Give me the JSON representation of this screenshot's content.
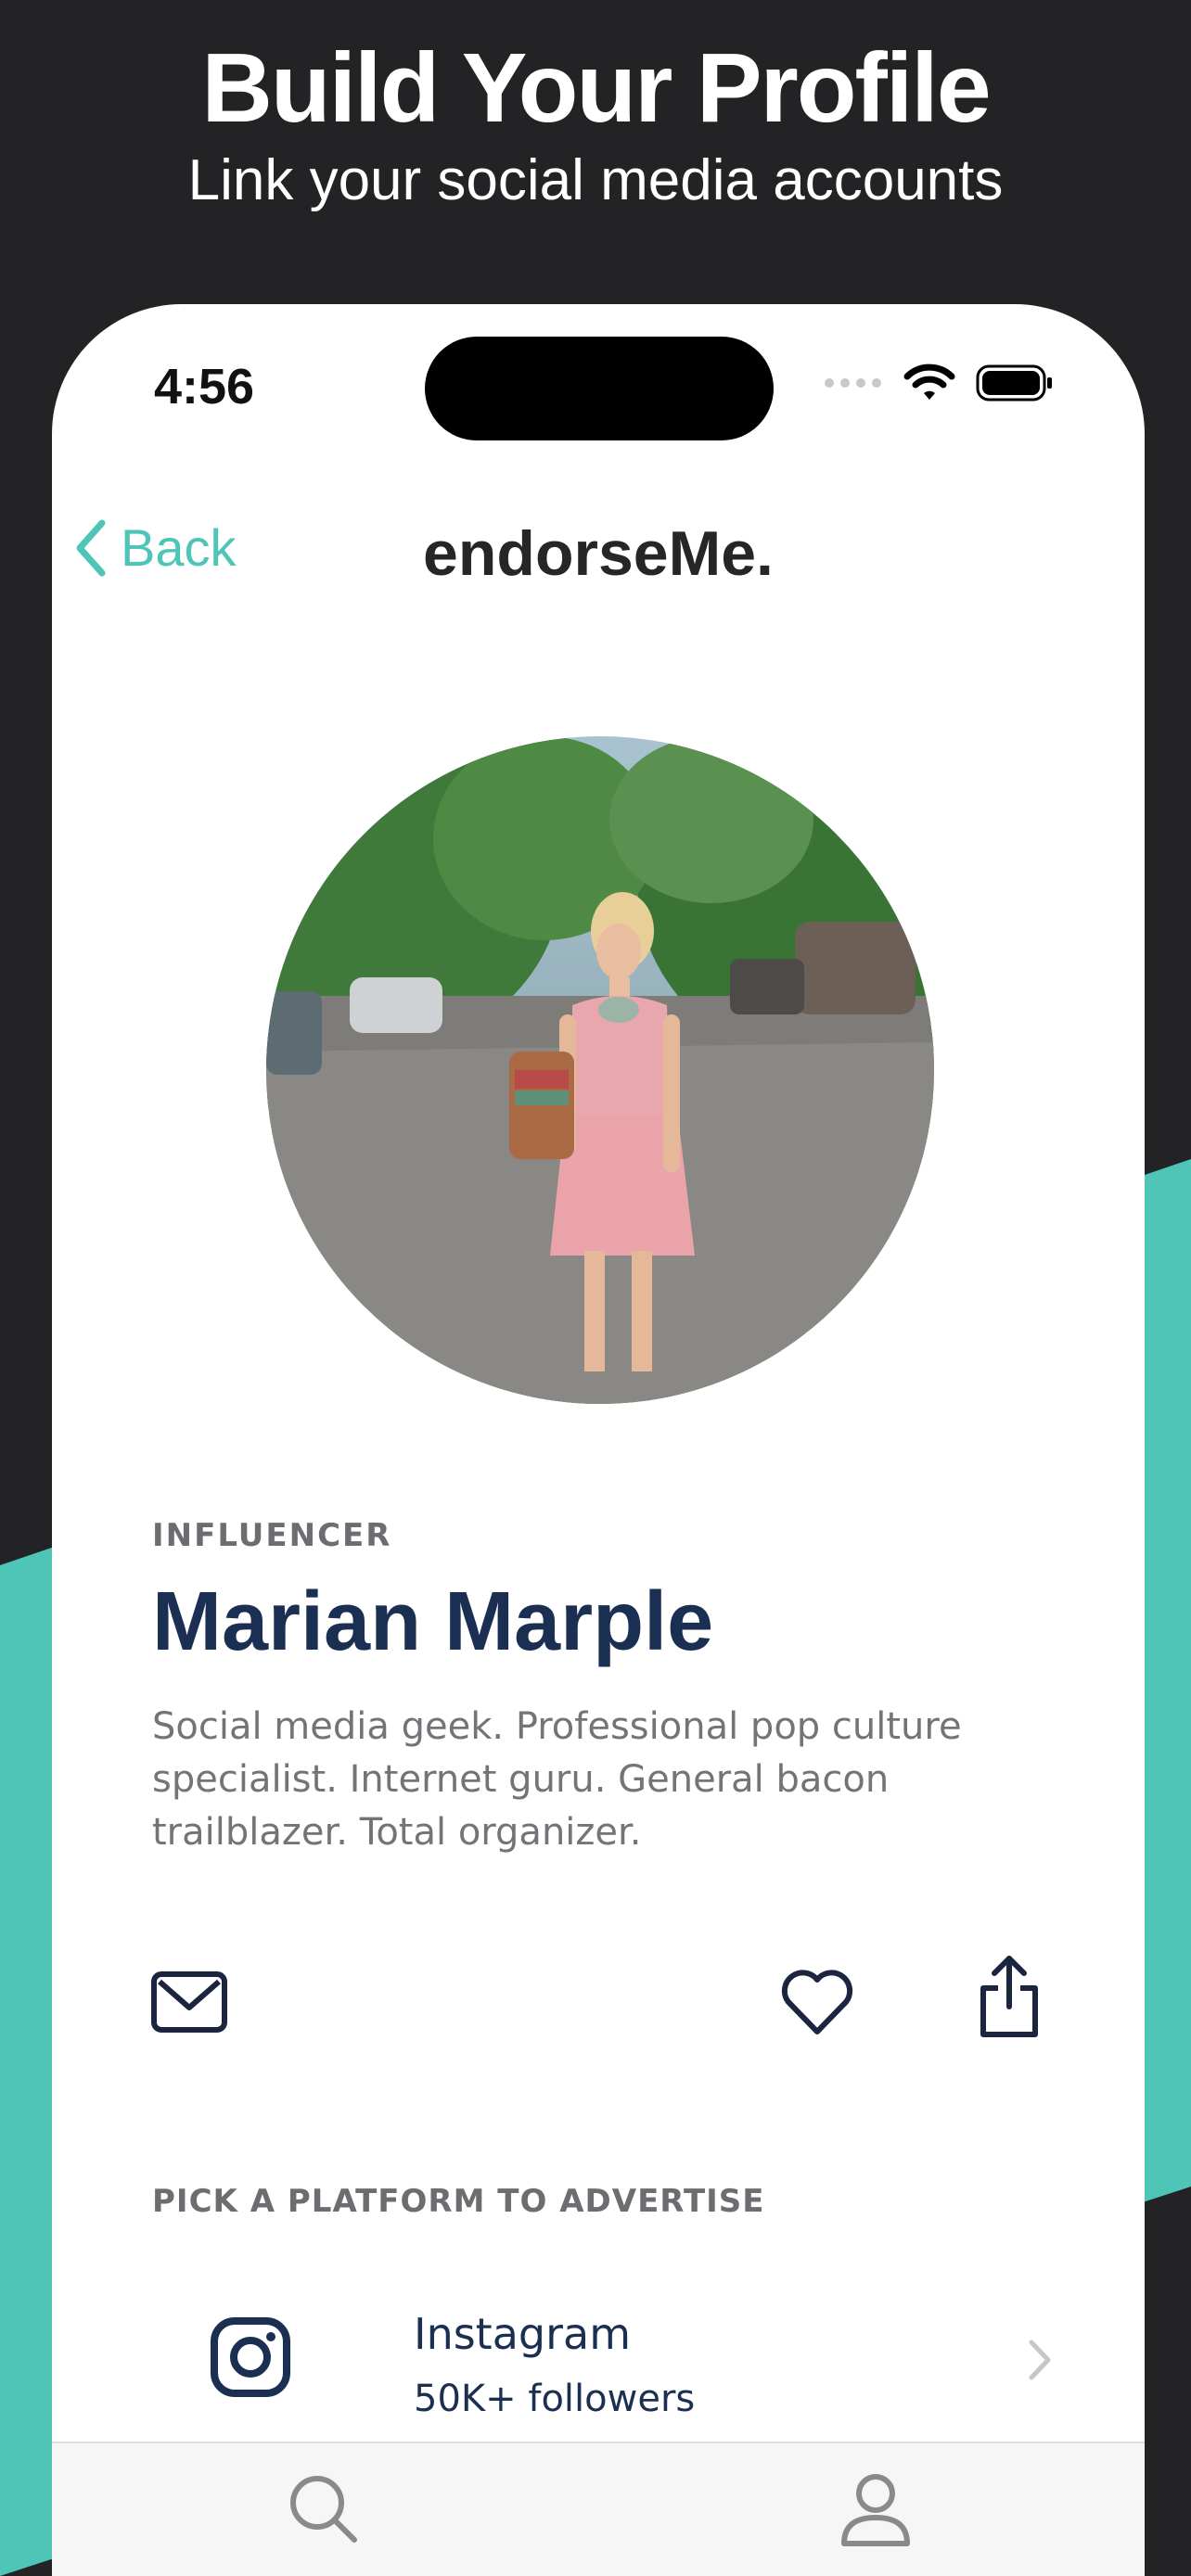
{
  "hero": {
    "title": "Build Your Profile",
    "subtitle": "Link your social media accounts"
  },
  "status_bar": {
    "time": "4:56"
  },
  "nav": {
    "back_label": "Back",
    "brand": "endorseMe."
  },
  "profile": {
    "role": "INFLUENCER",
    "name": "Marian Marple",
    "bio": "Social media geek. Professional pop culture specialist. Internet guru. General bacon trailblazer. Total organizer."
  },
  "actions": [
    "mail-icon",
    "heart-icon",
    "share-icon"
  ],
  "platforms": {
    "section_label": "PICK A PLATFORM TO ADVERTISE",
    "items": [
      {
        "name": "Instagram",
        "followers": "50K+ followers",
        "icon": "instagram-icon"
      }
    ]
  },
  "tab_bar": {
    "tabs": [
      "search-icon",
      "profile-icon"
    ]
  },
  "colors": {
    "accent": "#4ec5b6",
    "background": "#232325",
    "name": "#1b2f52",
    "muted": "#6b6d70"
  }
}
